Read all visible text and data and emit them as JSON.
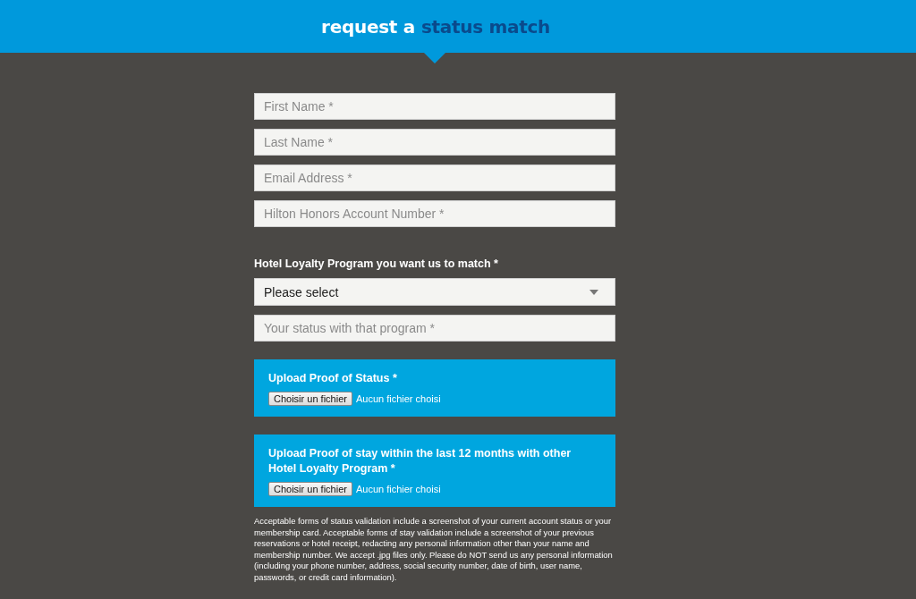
{
  "header": {
    "title_lead": "request a",
    "title_accent": "status match"
  },
  "fields": [
    {
      "placeholder": "First Name *"
    },
    {
      "placeholder": "Last Name *"
    },
    {
      "placeholder": "Email Address *"
    },
    {
      "placeholder": "Hilton Honors Account Number *"
    }
  ],
  "program_label": "Hotel Loyalty Program you want us to match *",
  "program_select": {
    "value": "Please select"
  },
  "status_field": {
    "placeholder": "Your status with that program *"
  },
  "uploads": [
    {
      "title": "Upload Proof of Status *",
      "button": "Choisir un fichier",
      "status": "Aucun fichier choisi"
    },
    {
      "title": "Upload Proof of stay within the last 12 months with other Hotel Loyalty Program *",
      "button": "Choisir un fichier",
      "status": "Aucun fichier choisi"
    }
  ],
  "note": "Acceptable forms of status validation include a screenshot of your current account status or your membership card. Acceptable forms of stay validation include a screenshot of your previous reservations or hotel receipt, redacting any personal information other than your name and membership number. We accept .jpg files only. Please do NOT send us any personal information (including your phone number, address, social security number, date of birth, user name, passwords, or credit card information)."
}
